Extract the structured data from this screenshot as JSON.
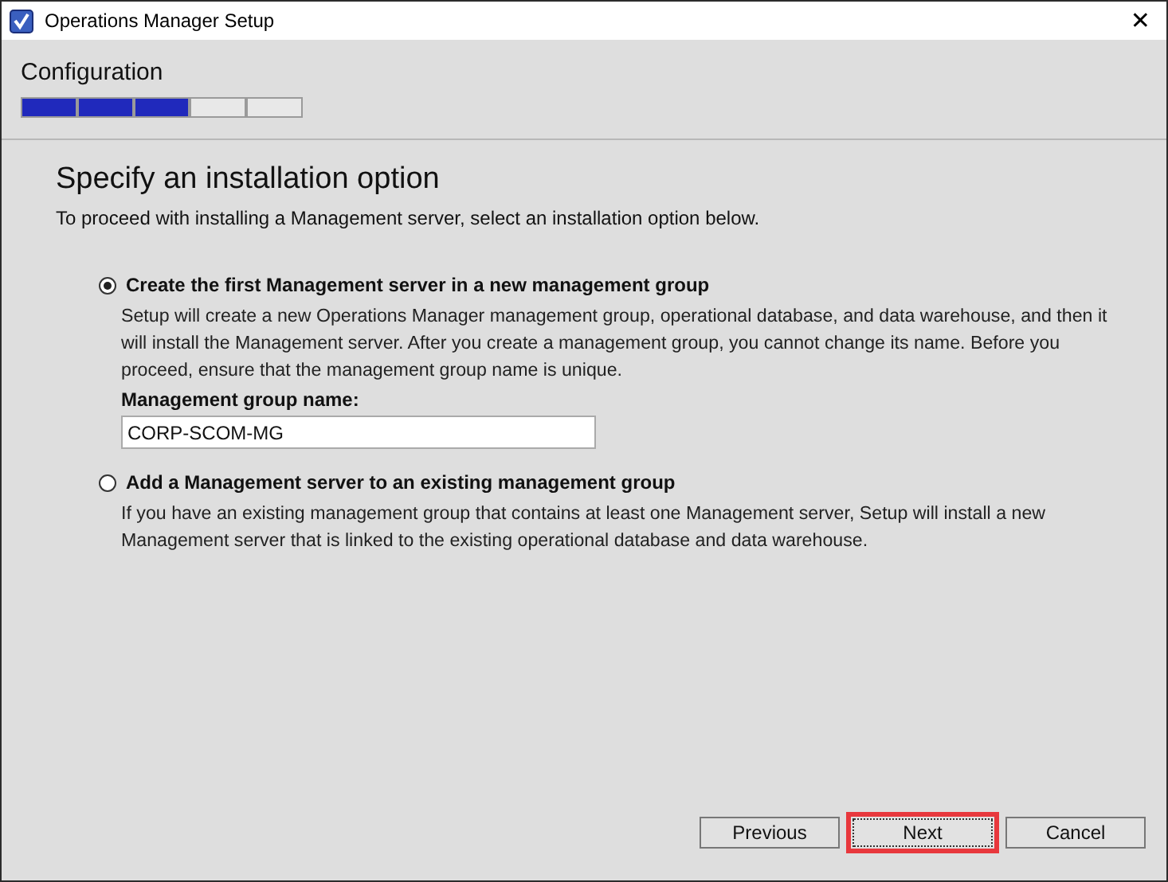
{
  "window": {
    "title": "Operations Manager Setup",
    "close": "✕"
  },
  "header": {
    "title": "Configuration",
    "progress": {
      "level": 0.6
    }
  },
  "page": {
    "heading": "Specify an installation option",
    "intro": "To proceed with installing a Management server, select an installation option below."
  },
  "options": [
    {
      "label": "Create the first Management server in a new management group",
      "selected": true,
      "description": "Setup will create a new Operations Manager management group, operational database, and data warehouse, and then it will install the Management server. After you create a management group, you cannot change its name. Before you proceed, ensure that the management group name is unique.",
      "field": {
        "label": "Management group name:",
        "value": "CORP-SCOM-MG"
      }
    },
    {
      "label": "Add a Management server to an existing management group",
      "selected": false,
      "description": "If you have an existing management group that contains at least one Management server, Setup will install a new Management server that is linked to the existing operational database and data warehouse."
    }
  ],
  "buttons": [
    {
      "label": "Previous",
      "focused": false,
      "highlighted": false
    },
    {
      "label": "Next",
      "focused": true,
      "highlighted": true
    },
    {
      "label": "Cancel",
      "focused": false,
      "highlighted": false
    }
  ]
}
